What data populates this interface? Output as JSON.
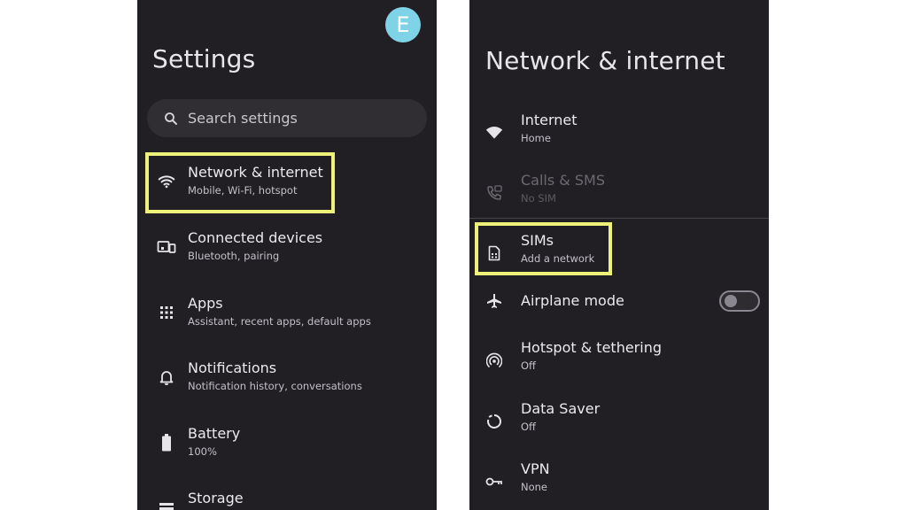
{
  "left_screen": {
    "avatar_letter": "E",
    "title": "Settings",
    "search_placeholder": "Search settings",
    "items": [
      {
        "title": "Network & internet",
        "subtitle": "Mobile, Wi-Fi, hotspot",
        "icon": "wifi-icon"
      },
      {
        "title": "Connected devices",
        "subtitle": "Bluetooth, pairing",
        "icon": "connected-devices-icon"
      },
      {
        "title": "Apps",
        "subtitle": "Assistant, recent apps, default apps",
        "icon": "apps-grid-icon"
      },
      {
        "title": "Notifications",
        "subtitle": "Notification history, conversations",
        "icon": "bell-icon"
      },
      {
        "title": "Battery",
        "subtitle": "100%",
        "icon": "battery-icon"
      },
      {
        "title": "Storage",
        "subtitle": "",
        "icon": "storage-icon"
      }
    ]
  },
  "right_screen": {
    "title": "Network & internet",
    "items": [
      {
        "title": "Internet",
        "subtitle": "Home",
        "icon": "wifi-icon"
      },
      {
        "title": "Calls & SMS",
        "subtitle": "No SIM",
        "icon": "calls-sms-icon"
      },
      {
        "title": "SIMs",
        "subtitle": "Add a network",
        "icon": "sim-card-icon"
      },
      {
        "title": "Airplane mode",
        "subtitle": "",
        "icon": "airplane-icon",
        "toggle": "off"
      },
      {
        "title": "Hotspot & tethering",
        "subtitle": "Off",
        "icon": "hotspot-icon"
      },
      {
        "title": "Data Saver",
        "subtitle": "Off",
        "icon": "data-saver-icon"
      },
      {
        "title": "VPN",
        "subtitle": "None",
        "icon": "vpn-key-icon"
      }
    ]
  },
  "colors": {
    "phone_background": "#211f23",
    "highlight": "#eef27a",
    "avatar": "#7fd3e6"
  }
}
